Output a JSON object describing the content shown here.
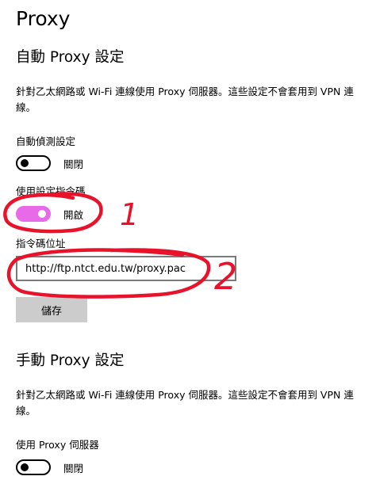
{
  "page": {
    "title": "Proxy"
  },
  "auto_proxy": {
    "heading": "自動 Proxy 設定",
    "description": "針對乙太網路或 Wi-Fi 連線使用 Proxy 伺服器。這些設定不會套用到 VPN 連線。",
    "auto_detect": {
      "label": "自動偵測設定",
      "state": "關閉",
      "on": false
    },
    "use_script": {
      "label": "使用設定指令碼",
      "state": "開啟",
      "on": true
    },
    "script_address": {
      "label": "指令碼位址",
      "value": "http://ftp.ntct.edu.tw/proxy.pac"
    },
    "save_label": "儲存"
  },
  "manual_proxy": {
    "heading": "手動 Proxy 設定",
    "description": "針對乙太網路或 Wi-Fi 連線使用 Proxy 伺服器。這些設定不會套用到 VPN 連線。",
    "use_server": {
      "label": "使用 Proxy 伺服器",
      "state": "關閉",
      "on": false
    }
  },
  "annotations": {
    "mark_1": "1",
    "mark_2": "2",
    "color": "#e8132a"
  },
  "colors": {
    "toggle_on": "#e86ae8",
    "button_bg": "#cccccc",
    "input_border": "#7a7a7a"
  }
}
